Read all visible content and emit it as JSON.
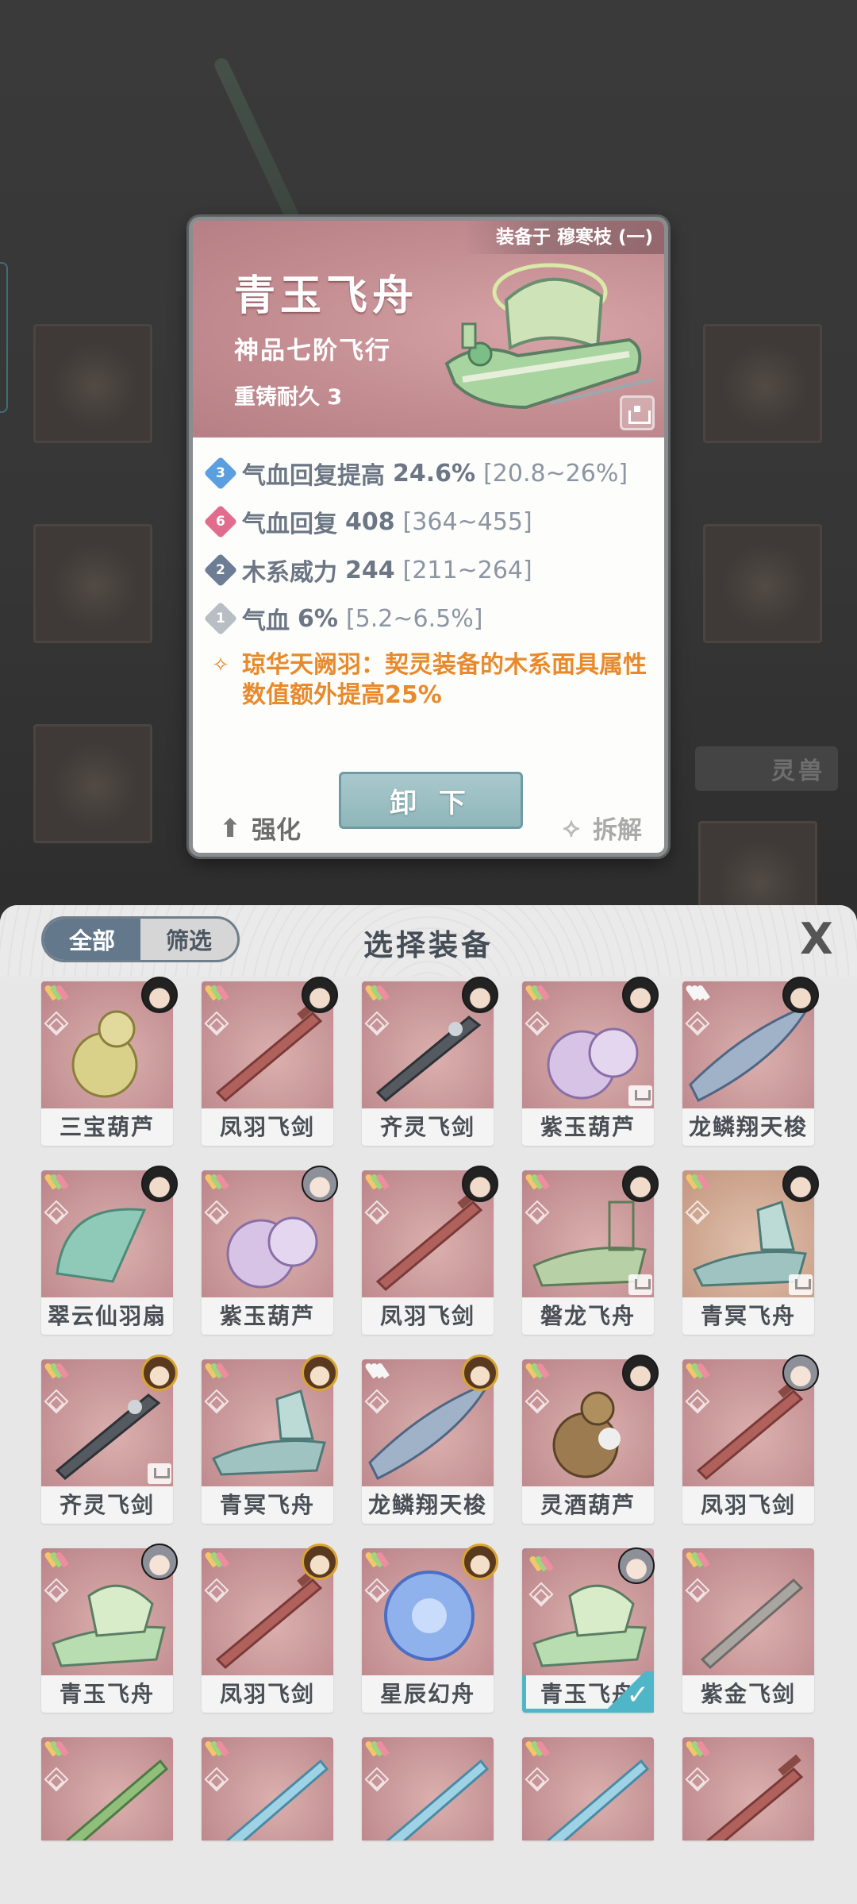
{
  "detail": {
    "equipped_on": "装备于 穆寒枝 (一)",
    "name": "青玉飞舟",
    "grade": "神品七阶飞行",
    "reforge": "重铸耐久 3",
    "attributes": [
      {
        "badge": "3",
        "name": "气血回复提高",
        "value": "24.6%",
        "range": "[20.8~26%]",
        "color": "#5b9fe0"
      },
      {
        "badge": "6",
        "name": "气血回复",
        "value": "408",
        "range": "[364~455]",
        "color": "#e06c8e"
      },
      {
        "badge": "2",
        "name": "木系威力",
        "value": "244",
        "range": "[211~264]",
        "color": "#6c7d94"
      },
      {
        "badge": "1",
        "name": "气血",
        "value": "6%",
        "range": "[5.2~6.5%]",
        "color": "#b9bec5"
      }
    ],
    "set_effect": "琼华天阙羽：契灵装备的木系面具属性数值额外提高25%",
    "buttons": {
      "strengthen": "强化",
      "unequip": "卸 下",
      "dismantle": "拆解"
    }
  },
  "background": {
    "side_label": "灵兽"
  },
  "panel": {
    "tabs": {
      "all": "全部",
      "filter": "筛选"
    },
    "title": "选择装备",
    "close": "X",
    "items": [
      {
        "label": "三宝葫芦",
        "bg": "pink",
        "wing": "color",
        "avatar": "dark",
        "lock": false,
        "selected": false,
        "art": "gourd-gold"
      },
      {
        "label": "凤羽飞剑",
        "bg": "pink",
        "wing": "color",
        "avatar": "dark",
        "lock": false,
        "selected": false,
        "art": "sword-red"
      },
      {
        "label": "齐灵飞剑",
        "bg": "pink",
        "wing": "color",
        "avatar": "dark",
        "lock": false,
        "selected": false,
        "art": "sword-dark"
      },
      {
        "label": "紫玉葫芦",
        "bg": "pink",
        "wing": "color",
        "avatar": "dark",
        "lock": true,
        "selected": false,
        "art": "gourd-purple"
      },
      {
        "label": "龙鳞翔天梭",
        "bg": "pink",
        "wing": "white",
        "avatar": "dark",
        "lock": false,
        "selected": false,
        "art": "shuttle-blue"
      },
      {
        "label": "翠云仙羽扇",
        "bg": "pink",
        "wing": "color",
        "avatar": "dark",
        "lock": false,
        "selected": false,
        "art": "fan-green"
      },
      {
        "label": "紫玉葫芦",
        "bg": "pink",
        "wing": "color",
        "avatar": "silver",
        "lock": false,
        "selected": false,
        "art": "gourd-purple"
      },
      {
        "label": "凤羽飞剑",
        "bg": "pink",
        "wing": "color",
        "avatar": "dark",
        "lock": false,
        "selected": false,
        "art": "sword-red"
      },
      {
        "label": "磐龙飞舟",
        "bg": "pink",
        "wing": "color",
        "avatar": "dark",
        "lock": true,
        "selected": false,
        "art": "boat-green"
      },
      {
        "label": "青冥飞舟",
        "bg": "brown",
        "wing": "color",
        "avatar": "dark",
        "lock": true,
        "selected": false,
        "art": "boat-teal"
      },
      {
        "label": "齐灵飞剑",
        "bg": "pink",
        "wing": "color",
        "avatar": "gold",
        "lock": true,
        "selected": false,
        "art": "sword-dark"
      },
      {
        "label": "青冥飞舟",
        "bg": "pink",
        "wing": "color",
        "avatar": "gold",
        "lock": false,
        "selected": false,
        "art": "boat-teal"
      },
      {
        "label": "龙鳞翔天梭",
        "bg": "pink",
        "wing": "white",
        "avatar": "gold",
        "lock": false,
        "selected": false,
        "art": "shuttle-blue"
      },
      {
        "label": "灵酒葫芦",
        "bg": "pink",
        "wing": "color",
        "avatar": "dark",
        "lock": false,
        "selected": false,
        "art": "gourd-brown"
      },
      {
        "label": "凤羽飞剑",
        "bg": "pink",
        "wing": "color",
        "avatar": "silver",
        "lock": false,
        "selected": false,
        "art": "sword-red"
      },
      {
        "label": "青玉飞舟",
        "bg": "pink",
        "wing": "color",
        "avatar": "silver",
        "lock": false,
        "selected": false,
        "art": "boat-jade"
      },
      {
        "label": "凤羽飞剑",
        "bg": "pink",
        "wing": "color",
        "avatar": "gold",
        "lock": false,
        "selected": false,
        "art": "sword-red"
      },
      {
        "label": "星辰幻舟",
        "bg": "pink",
        "wing": "color",
        "avatar": "gold",
        "lock": false,
        "selected": false,
        "art": "orb-blue"
      },
      {
        "label": "青玉飞舟",
        "bg": "pink",
        "wing": "color",
        "avatar": "silver",
        "lock": false,
        "selected": true,
        "art": "boat-jade"
      },
      {
        "label": "紫金飞剑",
        "bg": "pink",
        "wing": "color",
        "avatar": "none",
        "lock": false,
        "selected": false,
        "art": "sword-silver"
      },
      {
        "label": "",
        "bg": "pink",
        "wing": "color",
        "avatar": "none",
        "lock": false,
        "selected": false,
        "art": "sword-green"
      },
      {
        "label": "",
        "bg": "pink",
        "wing": "color",
        "avatar": "none",
        "lock": false,
        "selected": false,
        "art": "sword-ice"
      },
      {
        "label": "",
        "bg": "pink",
        "wing": "color",
        "avatar": "none",
        "lock": false,
        "selected": false,
        "art": "sword-ice"
      },
      {
        "label": "",
        "bg": "pink",
        "wing": "color",
        "avatar": "none",
        "lock": false,
        "selected": false,
        "art": "sword-ice"
      },
      {
        "label": "",
        "bg": "pink",
        "wing": "color",
        "avatar": "none",
        "lock": false,
        "selected": false,
        "art": "sword-red"
      }
    ]
  }
}
